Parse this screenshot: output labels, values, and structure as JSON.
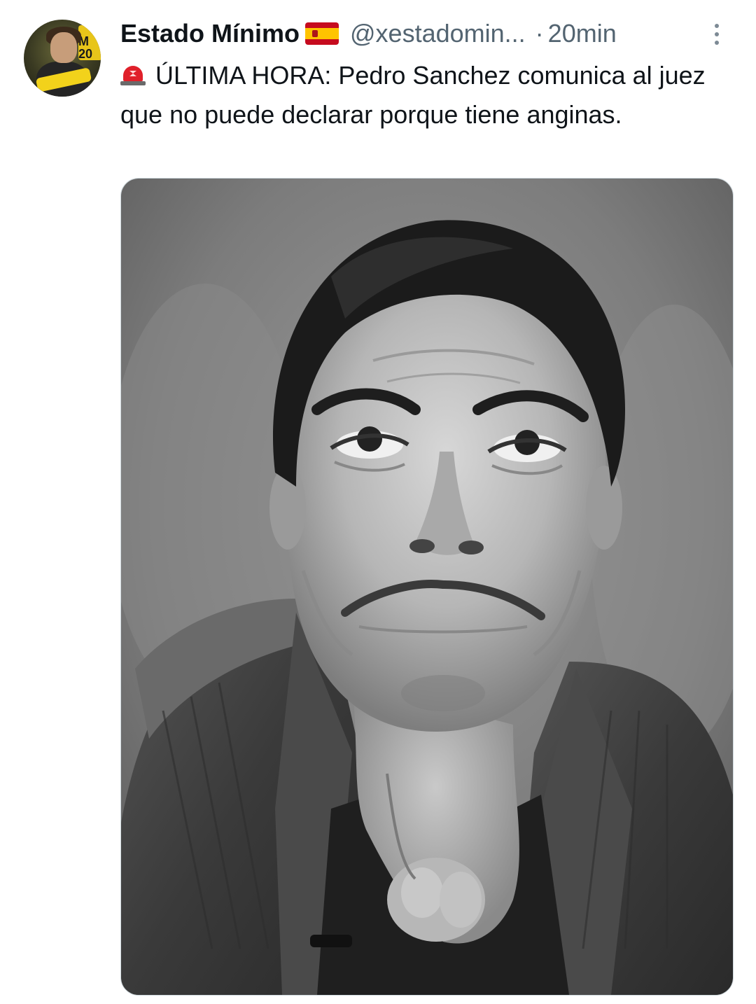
{
  "tweet": {
    "author": {
      "display_name": "Estado Mínimo",
      "flag_icon": "spain-flag-icon",
      "handle": "@xestadomin...",
      "separator": "·",
      "time": "20min",
      "avatar_icon": "user-avatar",
      "avatar_text": "M 20"
    },
    "more_icon": "more-vertical-icon",
    "text": {
      "emoji_icon": "siren-icon",
      "body": "ÚLTIMA HORA: Pedro Sanchez comunica al juez que no puede declarar porque tiene anginas."
    },
    "media": {
      "type": "photo",
      "style": "black-and-white portrait"
    },
    "colors": {
      "text_primary": "#0f1419",
      "text_secondary": "#536471",
      "background": "#ffffff",
      "media_border": "#cfd9de"
    }
  }
}
